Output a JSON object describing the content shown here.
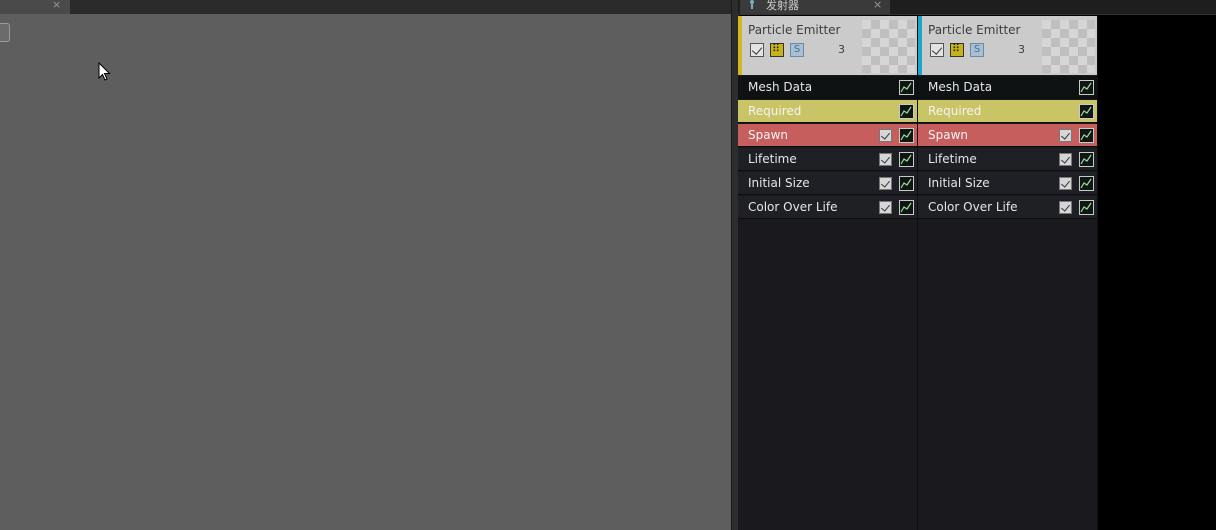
{
  "left_tab": {
    "close_label": "×"
  },
  "right_tab": {
    "title": "发射器",
    "close_label": "×"
  },
  "emitters": [
    {
      "name": "Particle Emitter",
      "count": "3",
      "accent_color": "#d4b61e",
      "solo_label": "S",
      "modules": [
        {
          "label": "Mesh Data",
          "kind": "mesh",
          "has_check": false
        },
        {
          "label": "Required",
          "kind": "req",
          "has_check": false
        },
        {
          "label": "Spawn",
          "kind": "spawn",
          "has_check": true
        },
        {
          "label": "Lifetime",
          "kind": "plain",
          "has_check": true
        },
        {
          "label": "Initial Size",
          "kind": "plain",
          "has_check": true
        },
        {
          "label": "Color Over Life",
          "kind": "plain",
          "has_check": true
        }
      ]
    },
    {
      "name": "Particle Emitter",
      "count": "3",
      "accent_color": "#1aa6c8",
      "solo_label": "S",
      "modules": [
        {
          "label": "Mesh Data",
          "kind": "mesh",
          "has_check": false
        },
        {
          "label": "Required",
          "kind": "req",
          "has_check": false
        },
        {
          "label": "Spawn",
          "kind": "spawn",
          "has_check": true
        },
        {
          "label": "Lifetime",
          "kind": "plain",
          "has_check": true
        },
        {
          "label": "Initial Size",
          "kind": "plain",
          "has_check": true
        },
        {
          "label": "Color Over Life",
          "kind": "plain",
          "has_check": true
        }
      ]
    }
  ]
}
